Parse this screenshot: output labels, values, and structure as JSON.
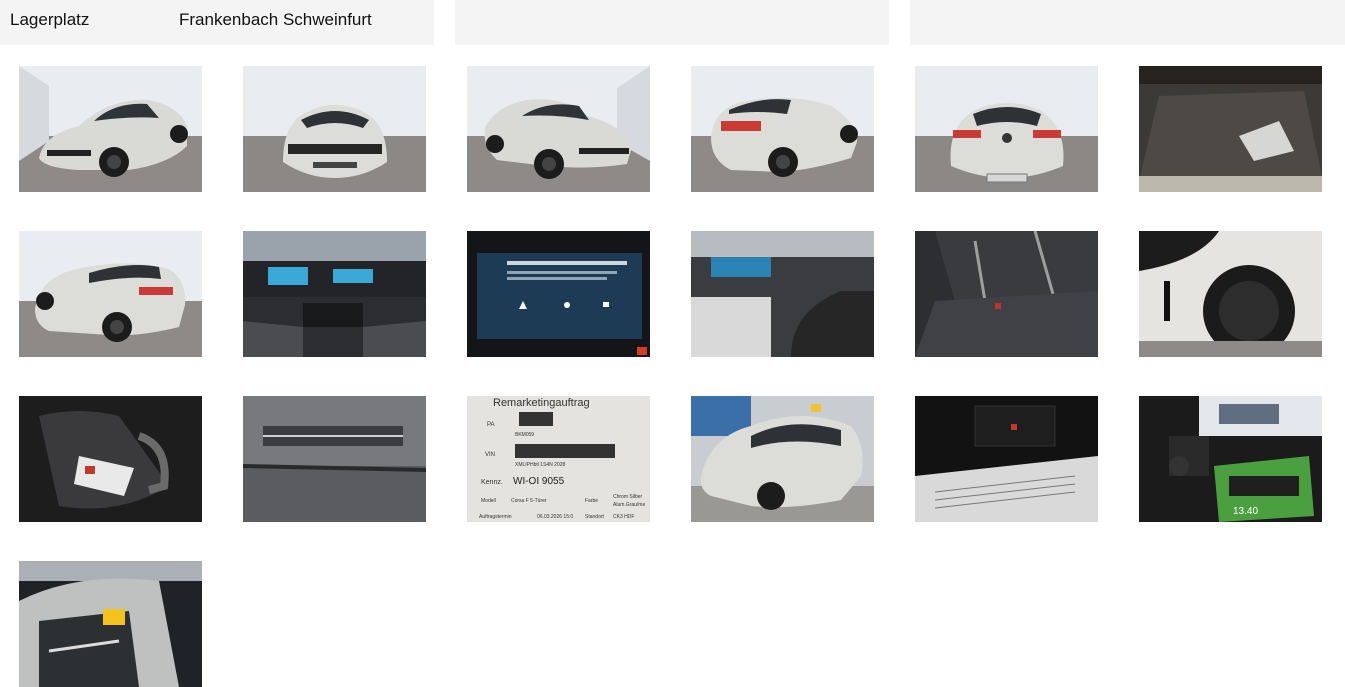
{
  "header": {
    "location_label": "Lagerplatz",
    "location_value": "Frankenbach Schweinfurt"
  },
  "photos": [
    {
      "subject": "front-left exterior"
    },
    {
      "subject": "front exterior"
    },
    {
      "subject": "front-right exterior"
    },
    {
      "subject": "rear-right exterior"
    },
    {
      "subject": "rear exterior"
    },
    {
      "subject": "trunk interior"
    },
    {
      "subject": "rear-left exterior"
    },
    {
      "subject": "dashboard cockpit"
    },
    {
      "subject": "infotainment screen"
    },
    {
      "subject": "driver footwell interior"
    },
    {
      "subject": "rear seats"
    },
    {
      "subject": "wheel detail"
    },
    {
      "subject": "repair kit bag"
    },
    {
      "subject": "windshield wiper area"
    },
    {
      "subject": "remarketing order document"
    },
    {
      "subject": "car in workshop"
    },
    {
      "subject": "glovebox documents"
    },
    {
      "subject": "keys and brochure"
    },
    {
      "subject": "roof and windshield"
    }
  ],
  "document_photo": {
    "title": "Remarketingauftrag",
    "pa_label": "PA",
    "pa_value": "BKM059",
    "vin_label": "VIN",
    "vin_value": "XMLIPHbtl 1S4N 2028",
    "kennz_label": "Kennz.",
    "kennz_value": "WI-OI 9055",
    "model_label": "Modell",
    "model_value": "Corsa F 5-Türer",
    "farbe_label": "Farbe",
    "farbe_value": "Chrom Silber",
    "farbe_value2": "Alum.Grau/me",
    "auftrag_label": "Auftragstermin",
    "auftrag_value": "06.03.2026 15:0",
    "standort_label": "Standort",
    "standort_value": "CK3 HDF"
  },
  "brochure_photo": {
    "price_text": "13.40"
  }
}
